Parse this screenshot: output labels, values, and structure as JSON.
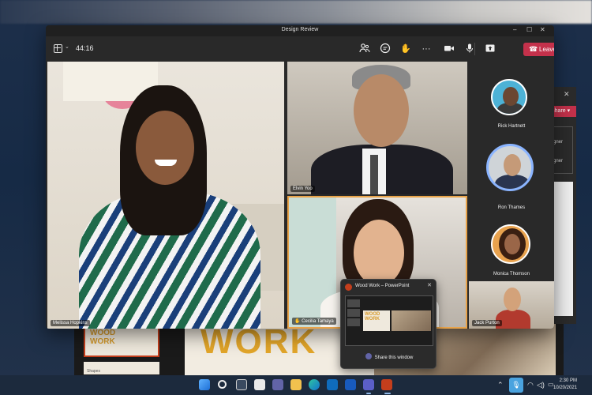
{
  "window": {
    "title": "Design Review"
  },
  "toolbar": {
    "timer": "44:16",
    "leave_label": "Leave",
    "icons": [
      "grid-icon",
      "people-icon",
      "chat-icon",
      "raise-hand-icon",
      "more-icon",
      "camera-icon",
      "mic-icon",
      "share-tray-icon",
      "phone-icon"
    ]
  },
  "participants": {
    "tiles": [
      {
        "name": "Melissa Hopkins"
      },
      {
        "name": "Elvin Yoo"
      },
      {
        "name": "Cecilia Tamaya"
      }
    ],
    "roster": [
      {
        "name": "Rick Hartnett"
      },
      {
        "name": "Ron Thames"
      },
      {
        "name": "Monica Thomson"
      },
      {
        "name": "Jack Purton"
      }
    ]
  },
  "background_app": {
    "slide_title": "WORK",
    "thumb_title": "WOOD\nWORK",
    "thumb2_label": "Shapes",
    "share_label": "Share",
    "designer_labels": [
      "gner",
      "gner"
    ]
  },
  "popup": {
    "title": "Wood Work – PowerPoint",
    "share_label": "Share this window",
    "thumb_title": "WOOD WORK"
  },
  "taskbar": {
    "time": "2:30 PM",
    "date": "10/20/2021"
  },
  "colors": {
    "leave": "#c4314b",
    "active_speaker_border": "#e8a34a",
    "powerpoint": "#c43e1c",
    "accent_title": "#e3a62a"
  }
}
